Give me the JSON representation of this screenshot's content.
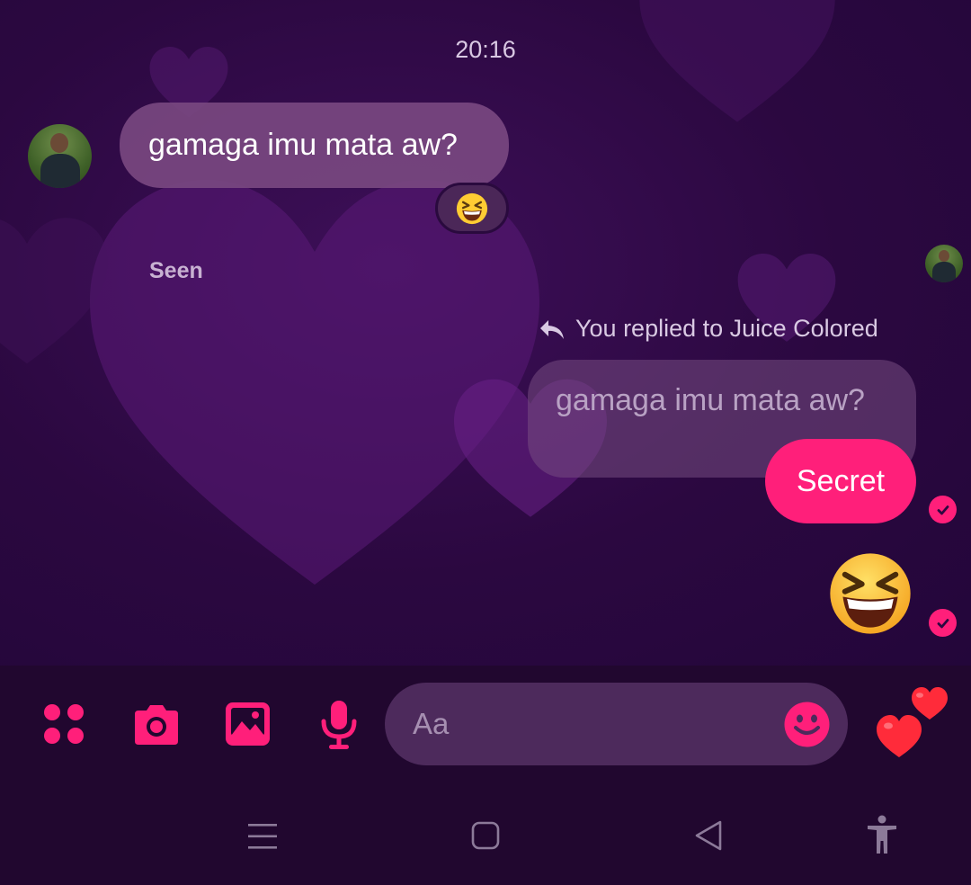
{
  "timestamp": "20:16",
  "conversation": {
    "incoming": {
      "text": "gamaga imu mata aw?",
      "reaction": "laughing-squinting-face",
      "status": "Seen"
    },
    "outgoing": {
      "reply_context": "You replied to Juice Colored",
      "quoted_text": "gamaga imu mata aw?",
      "text": "Secret",
      "emoji_message": "laughing-squinting-face"
    }
  },
  "composer": {
    "placeholder": "Aa",
    "tools": [
      "apps-icon",
      "camera-icon",
      "gallery-icon",
      "microphone-icon"
    ],
    "emoji_button": "smiley-icon",
    "quick_reaction": "hearts-icon"
  },
  "navigation": [
    "recents-icon",
    "home-icon",
    "back-icon",
    "accessibility-icon"
  ],
  "colors": {
    "accent": "#ff1f7a",
    "background": "#2b0840",
    "incoming_bubble": "#784880",
    "composer_background": "#21072f"
  }
}
